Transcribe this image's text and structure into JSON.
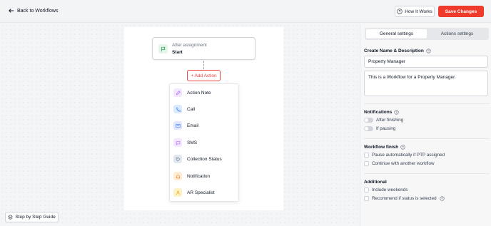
{
  "header": {
    "back_label": "Back to Workflows",
    "how_label": "How It Works",
    "save_label": "Save Changes"
  },
  "start_node": {
    "subtitle": "After assignment",
    "title": "Start"
  },
  "add_action_label": "+ Add Action",
  "action_menu": [
    {
      "label": "Action Note",
      "icon": "edit-icon",
      "color": "#a855f7",
      "bg": "#f3e8ff"
    },
    {
      "label": "Call",
      "icon": "phone-icon",
      "color": "#3b82f6",
      "bg": "#dbeafe"
    },
    {
      "label": "Email",
      "icon": "mail-icon",
      "color": "#3b82f6",
      "bg": "#e0e7ff"
    },
    {
      "label": "SMS",
      "icon": "message-icon",
      "color": "#a855f7",
      "bg": "#f3e8ff"
    },
    {
      "label": "Collection Status",
      "icon": "tag-icon",
      "color": "#64748b",
      "bg": "#e2e8f0"
    },
    {
      "label": "Notification",
      "icon": "bell-icon",
      "color": "#f97316",
      "bg": "#ffedd5"
    },
    {
      "label": "AR Specialist",
      "icon": "user-icon",
      "color": "#f59e0b",
      "bg": "#fef3c7"
    }
  ],
  "guide_label": "Step by Step Guide",
  "panel": {
    "tabs": [
      "General settings",
      "Actions settings"
    ],
    "active_tab": "General settings",
    "name_heading": "Create Name & Description",
    "name_value": "Property Manager",
    "description_value": "This is a Workflow for a Property Manager.",
    "notifications_heading": "Notifications",
    "notifications": [
      "After finishing",
      "If pausing"
    ],
    "finish_heading": "Workflow finish",
    "finish_options": [
      "Pause automatically if PTP assigned",
      "Continue with another workflow"
    ],
    "additional_heading": "Additional",
    "additional_options": [
      "Include weekends",
      "Recommend if status is selected"
    ]
  },
  "colors": {
    "accent": "#ef3b2c",
    "start_icon": "#16a34a"
  }
}
